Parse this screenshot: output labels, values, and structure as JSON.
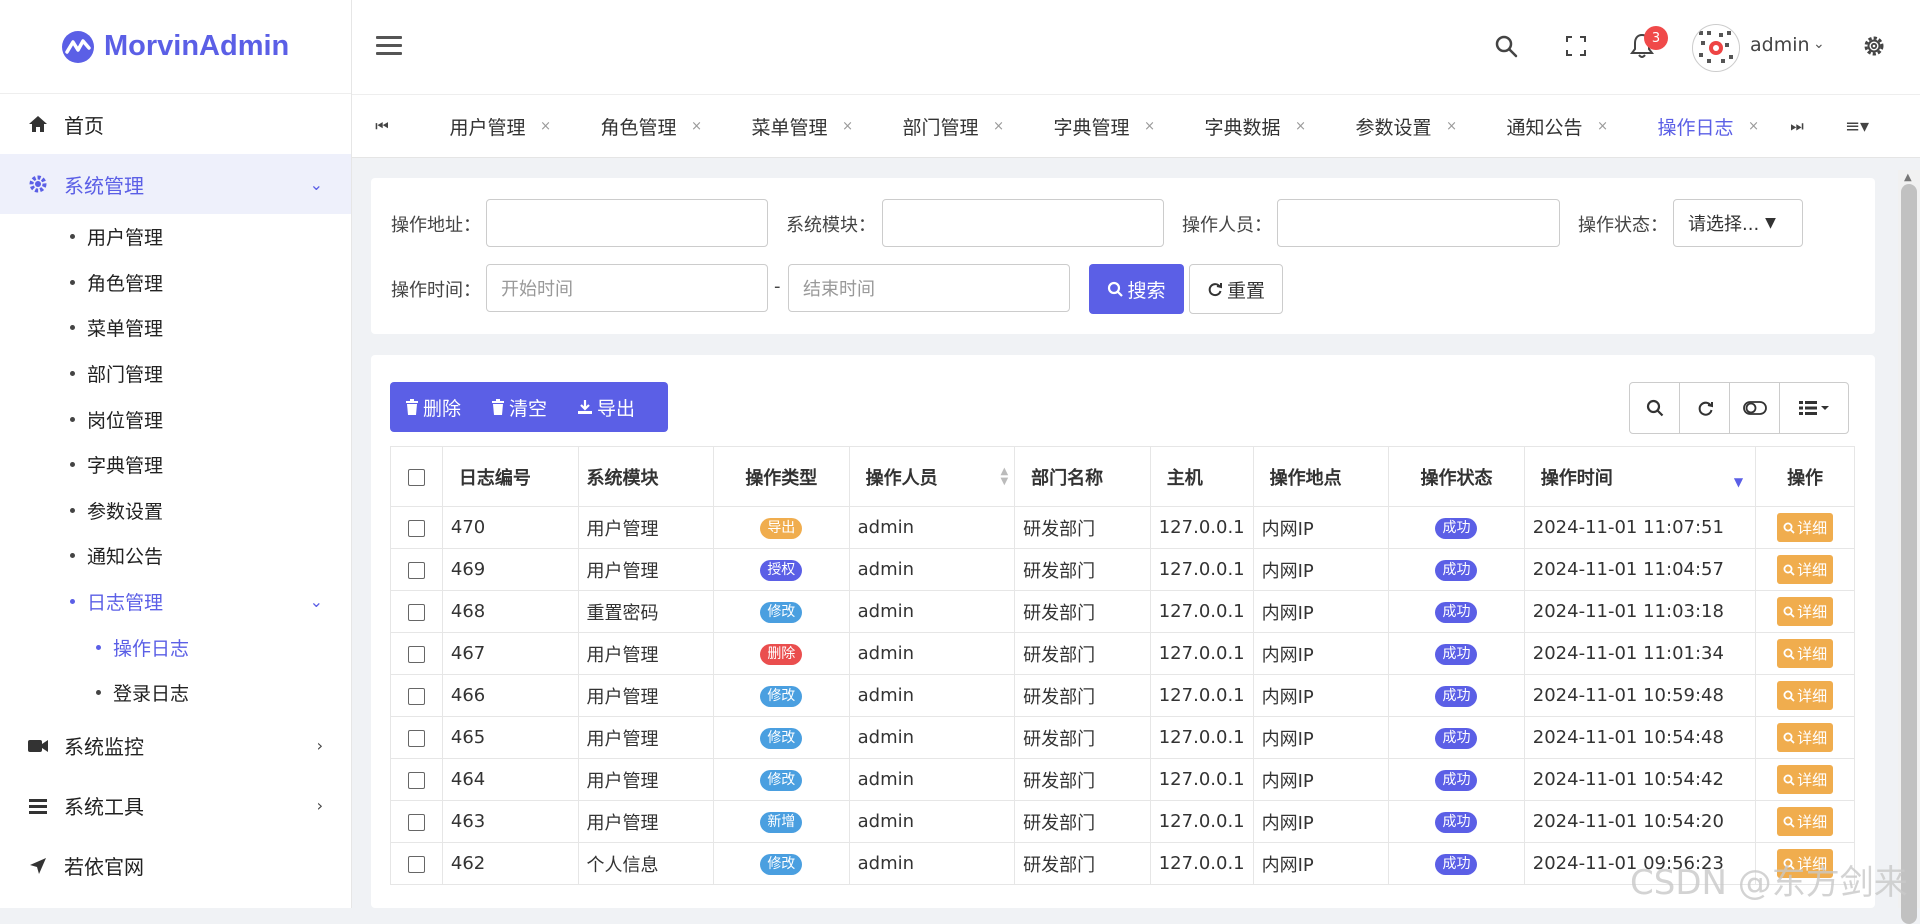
{
  "app": {
    "name": "MorvinAdmin"
  },
  "sidebar": {
    "home": "首页",
    "system": "系统管理",
    "system_items": [
      "用户管理",
      "角色管理",
      "菜单管理",
      "部门管理",
      "岗位管理",
      "字典管理",
      "参数设置",
      "通知公告"
    ],
    "log": "日志管理",
    "log_items": [
      "操作日志",
      "登录日志"
    ],
    "monitor": "系统监控",
    "tools": "系统工具",
    "website": "若依官网"
  },
  "header": {
    "username": "admin",
    "notification_count": "3"
  },
  "tabs": [
    {
      "label": "用户管理",
      "close": "×"
    },
    {
      "label": "角色管理",
      "close": "×"
    },
    {
      "label": "菜单管理",
      "close": "×"
    },
    {
      "label": "部门管理",
      "close": "×"
    },
    {
      "label": "字典管理",
      "close": "×"
    },
    {
      "label": "字典数据",
      "close": "×"
    },
    {
      "label": "参数设置",
      "close": "×"
    },
    {
      "label": "通知公告",
      "close": "×"
    },
    {
      "label": "操作日志",
      "close": "×"
    }
  ],
  "search": {
    "address_label": "操作地址：",
    "module_label": "系统模块：",
    "operator_label": "操作人员：",
    "status_label": "操作状态：",
    "status_value": "请选择...",
    "time_label": "操作时间：",
    "start_placeholder": "开始时间",
    "separator": "-",
    "end_placeholder": "结束时间",
    "search_button": "搜索",
    "reset_button": "重置"
  },
  "toolbar": {
    "delete": "删除",
    "clear": "清空",
    "export": "导出"
  },
  "table": {
    "headers": [
      "日志编号",
      "系统模块",
      "操作类型",
      "操作人员",
      "部门名称",
      "主机",
      "操作地点",
      "操作状态",
      "操作时间",
      "操作"
    ],
    "detail_label": "详细",
    "rows": [
      {
        "id": "470",
        "module": "用户管理",
        "type": "导出",
        "type_color": "export",
        "operator": "admin",
        "dept": "研发部门",
        "host": "127.0.0.1",
        "location": "内网IP",
        "status": "成功",
        "time": "2024-11-01 11:07:51"
      },
      {
        "id": "469",
        "module": "用户管理",
        "type": "授权",
        "type_color": "grant",
        "operator": "admin",
        "dept": "研发部门",
        "host": "127.0.0.1",
        "location": "内网IP",
        "status": "成功",
        "time": "2024-11-01 11:04:57"
      },
      {
        "id": "468",
        "module": "重置密码",
        "type": "修改",
        "type_color": "edit",
        "operator": "admin",
        "dept": "研发部门",
        "host": "127.0.0.1",
        "location": "内网IP",
        "status": "成功",
        "time": "2024-11-01 11:03:18"
      },
      {
        "id": "467",
        "module": "用户管理",
        "type": "删除",
        "type_color": "delete",
        "operator": "admin",
        "dept": "研发部门",
        "host": "127.0.0.1",
        "location": "内网IP",
        "status": "成功",
        "time": "2024-11-01 11:01:34"
      },
      {
        "id": "466",
        "module": "用户管理",
        "type": "修改",
        "type_color": "edit",
        "operator": "admin",
        "dept": "研发部门",
        "host": "127.0.0.1",
        "location": "内网IP",
        "status": "成功",
        "time": "2024-11-01 10:59:48"
      },
      {
        "id": "465",
        "module": "用户管理",
        "type": "修改",
        "type_color": "edit",
        "operator": "admin",
        "dept": "研发部门",
        "host": "127.0.0.1",
        "location": "内网IP",
        "status": "成功",
        "time": "2024-11-01 10:54:48"
      },
      {
        "id": "464",
        "module": "用户管理",
        "type": "修改",
        "type_color": "edit",
        "operator": "admin",
        "dept": "研发部门",
        "host": "127.0.0.1",
        "location": "内网IP",
        "status": "成功",
        "time": "2024-11-01 10:54:42"
      },
      {
        "id": "463",
        "module": "用户管理",
        "type": "新增",
        "type_color": "add",
        "operator": "admin",
        "dept": "研发部门",
        "host": "127.0.0.1",
        "location": "内网IP",
        "status": "成功",
        "time": "2024-11-01 10:54:20"
      },
      {
        "id": "462",
        "module": "个人信息",
        "type": "修改",
        "type_color": "edit",
        "operator": "admin",
        "dept": "研发部门",
        "host": "127.0.0.1",
        "location": "内网IP",
        "status": "成功",
        "time": "2024-11-01 09:56:23"
      }
    ]
  },
  "watermark": "CSDN @东方剑来",
  "colors": {
    "primary": "#5b5fe6",
    "warning": "#f0ad4e",
    "danger": "#ea4e4e",
    "info": "#4a9fe0"
  }
}
